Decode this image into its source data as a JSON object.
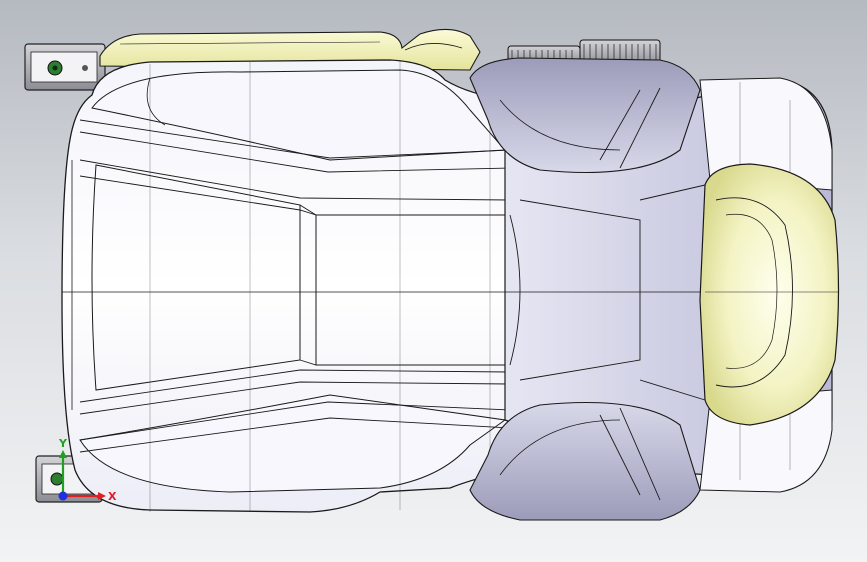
{
  "viewport": {
    "background_top": "#b5b9c0",
    "background_bottom": "#f2f3f4"
  },
  "model": {
    "part": "car-seat-top-view",
    "body_color": "#ffffff",
    "shade_color": "#c8c8e0",
    "headrest_color": "#f0f0b4",
    "edge_color": "#1a1a1a"
  },
  "triad": {
    "x_label": "X",
    "y_label": "Y",
    "x_color": "#e02020",
    "y_color": "#20a020",
    "z_color": "#2030e0"
  }
}
